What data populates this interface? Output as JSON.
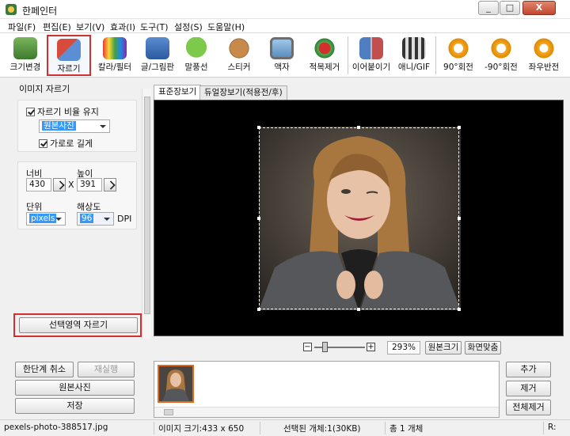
{
  "window": {
    "title": "한페인터",
    "min": "_",
    "max": "□",
    "close": "X"
  },
  "menu": [
    "파일(F)",
    "편집(E)",
    "보기(V)",
    "효과(I)",
    "도구(T)",
    "설정(S)",
    "도움말(H)"
  ],
  "toolbar": [
    {
      "label": "크기변경",
      "icon": "resize-icon"
    },
    {
      "label": "자르기",
      "icon": "crop-icon",
      "selected": true
    },
    {
      "label": "칼라/필터",
      "icon": "color-filter-icon"
    },
    {
      "label": "글/그림판",
      "icon": "text-draw-icon"
    },
    {
      "label": "말풍선",
      "icon": "speech-bubble-icon"
    },
    {
      "label": "스티커",
      "icon": "sticker-icon"
    },
    {
      "label": "액자",
      "icon": "frame-icon"
    },
    {
      "label": "적목제거",
      "icon": "red-eye-icon"
    },
    {
      "label": "이어붙이기",
      "icon": "merge-icon"
    },
    {
      "label": "애니/GIF",
      "icon": "gif-icon"
    },
    {
      "label": "90°회전",
      "icon": "rotate-right-icon"
    },
    {
      "label": "-90°회전",
      "icon": "rotate-left-icon"
    },
    {
      "label": "좌우반전",
      "icon": "flip-icon"
    }
  ],
  "crop_panel": {
    "title": "이미지 자르기",
    "keep_ratio_label": "자르기 비율 유지",
    "ratio_value": "원본사진",
    "landscape_label": "가로로 길게",
    "width_label": "너비",
    "height_label": "높이",
    "width_value": "430",
    "times": "X",
    "height_value": "391",
    "unit_label": "단위",
    "unit_value": "pixels",
    "resolution_label": "해상도",
    "resolution_value": "96",
    "dpi_label": "DPI",
    "crop_button": "선택영역 자르기"
  },
  "preview": {
    "tab_standard": "표준장보기",
    "tab_dual": "듀얼장보기(적용전/후)",
    "zoom_value": "293%",
    "original_size_button": "원본크기",
    "fit_screen_button": "화면맞춤"
  },
  "history": {
    "undo": "한단계 취소",
    "redo": "재실행",
    "original": "원본사진",
    "save": "저장"
  },
  "list_buttons": {
    "add": "추가",
    "remove": "제거",
    "remove_all": "전체제거"
  },
  "status": {
    "filename": "pexels-photo-388517.jpg",
    "image_size": "이미지 크기:433 x 650",
    "selected": "선택된 개체:1(30KB)",
    "total": "총 1 개체",
    "extra": "R:"
  },
  "colors": {
    "accent_red": "#d32f2f",
    "selection_blue": "#3399ff",
    "thumb_border": "#e06a1b"
  }
}
